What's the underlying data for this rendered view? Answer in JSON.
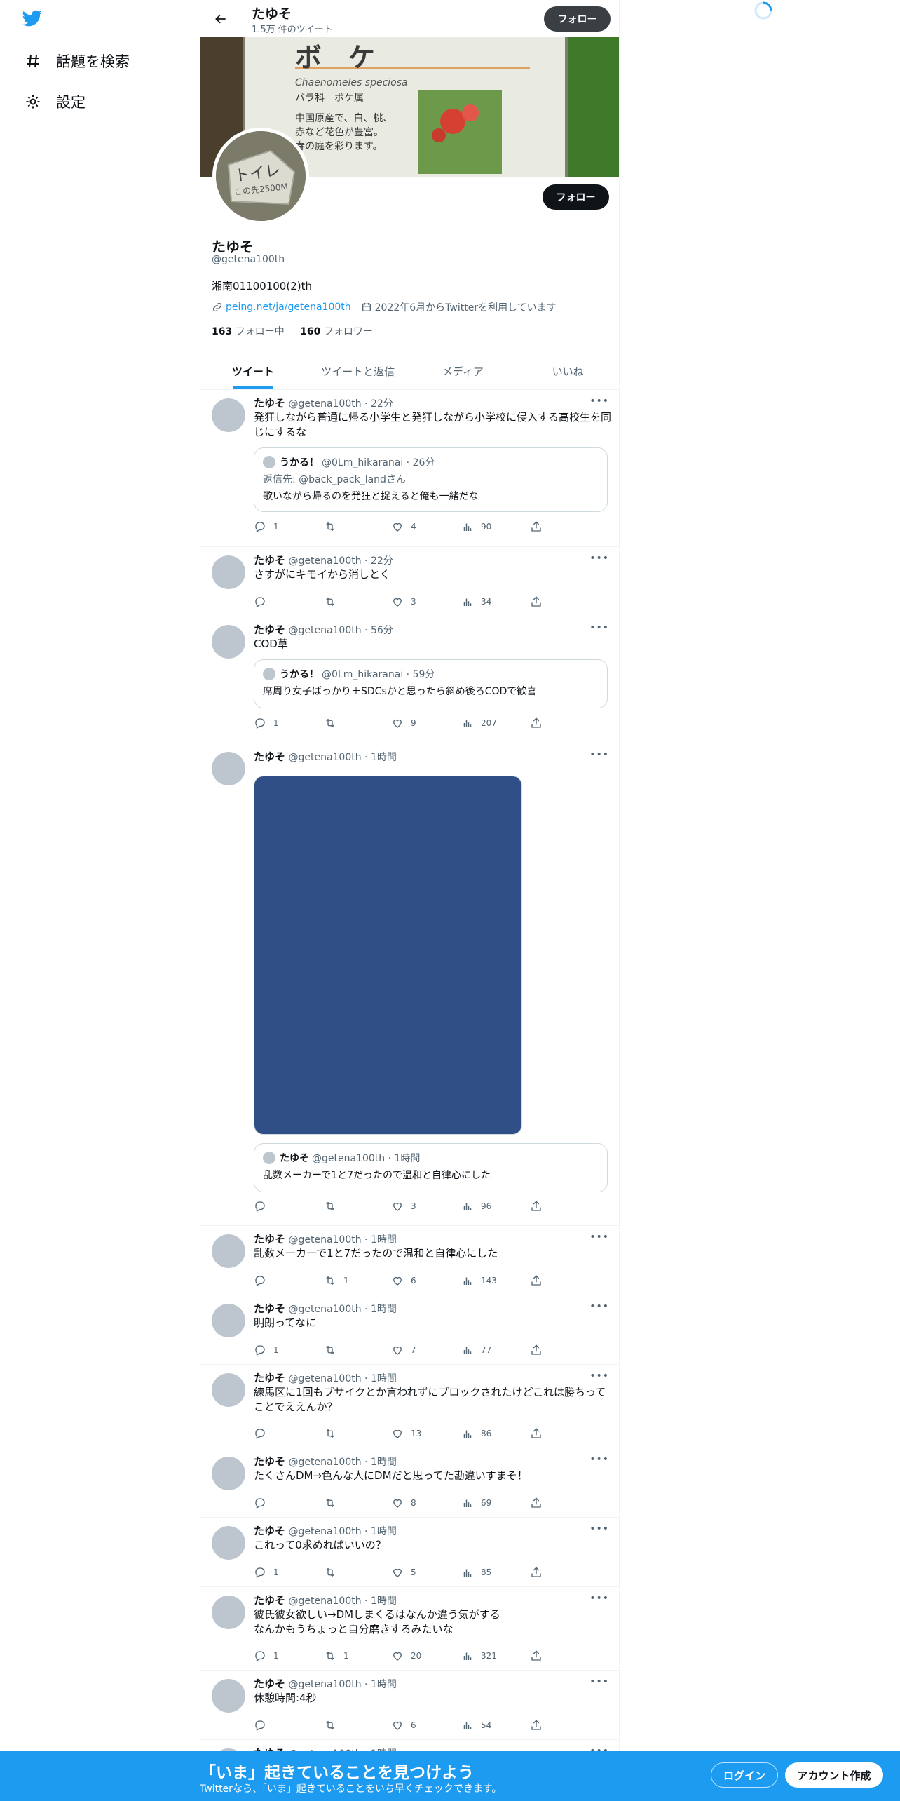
{
  "nav": {
    "logo": "twitter-bird-icon",
    "explore_label": "話題を検索",
    "settings_label": "設定"
  },
  "header": {
    "name": "たゆそ",
    "tweet_count": "1.5万 件のツイート",
    "follow_label": "フォロー"
  },
  "banner": {
    "sign_title": "ボ　ケ",
    "sign_latin": "Chaenomeles speciosa",
    "sign_family": "バラ科　ボケ属",
    "sign_desc1": "中国原産で、白、桃、",
    "sign_desc2": "赤など花色が豊富。",
    "sign_desc3": "春の庭を彩ります。"
  },
  "avatar_sign": {
    "line1": "トイレ",
    "line2": "この先2500M"
  },
  "profile": {
    "name": "たゆそ",
    "handle": "@getena100th",
    "bio": "湘南01100100(2)th",
    "link": "peing.net/ja/getena100th",
    "joined": "2022年6月からTwitterを利用しています",
    "following_count": "163",
    "following_label": "フォロー中",
    "followers_count": "160",
    "followers_label": "フォロワー",
    "follow_label": "フォロー"
  },
  "tabs": [
    "ツイート",
    "ツイートと返信",
    "メディア",
    "いいね"
  ],
  "tweets": [
    {
      "name": "たゆそ",
      "meta": "@getena100th · 22分",
      "text": "発狂しながら普通に帰る小学生と発狂しながら小学校に侵入する高校生を同じにするな",
      "quote": {
        "name": "うかる！",
        "meta": "@0Lm_hikaranai · 26分",
        "reply_prefix": "返信先: ",
        "reply_to": "@back_pack_landさん",
        "text": "歌いながら帰るのを発狂と捉えると俺も一緒だな"
      },
      "replies": "1",
      "retweets": "",
      "likes": "4",
      "views": "90"
    },
    {
      "name": "たゆそ",
      "meta": "@getena100th · 22分",
      "text": "さすがにキモイから消しとく",
      "replies": "",
      "retweets": "",
      "likes": "3",
      "views": "34"
    },
    {
      "name": "たゆそ",
      "meta": "@getena100th · 56分",
      "text": "COD草",
      "quote": {
        "name": "うかる！",
        "meta": "@0Lm_hikaranai · 59分",
        "text": "席周り女子ばっかり＋SDCsかと思ったら斜め後ろCODで歓喜"
      },
      "replies": "1",
      "retweets": "",
      "likes": "9",
      "views": "207"
    },
    {
      "name": "たゆそ",
      "meta": "@getena100th · 1時間",
      "text": "",
      "quote": {
        "name": "たゆそ",
        "meta": "@getena100th · 1時間",
        "text": "乱数メーカーで1と7だったので温和と自律心にした"
      },
      "replies": "",
      "retweets": "",
      "likes": "3",
      "views": "96"
    },
    {
      "name": "たゆそ",
      "meta": "@getena100th · 1時間",
      "text": "乱数メーカーで1と7だったので温和と自律心にした",
      "replies": "",
      "retweets": "1",
      "likes": "6",
      "views": "143"
    },
    {
      "name": "たゆそ",
      "meta": "@getena100th · 1時間",
      "text": "明朗ってなに",
      "replies": "1",
      "retweets": "",
      "likes": "7",
      "views": "77"
    },
    {
      "name": "たゆそ",
      "meta": "@getena100th · 1時間",
      "text": "練馬区に1回もブサイクとか言われずにブロックされたけどこれは勝ちってことでええんか？",
      "replies": "",
      "retweets": "",
      "likes": "13",
      "views": "86"
    },
    {
      "name": "たゆそ",
      "meta": "@getena100th · 1時間",
      "text": "たくさんDM→色んな人にDMだと思ってた勘違いすまそ！",
      "replies": "",
      "retweets": "",
      "likes": "8",
      "views": "69"
    },
    {
      "name": "たゆそ",
      "meta": "@getena100th · 1時間",
      "text": "これって0求めればいいの？",
      "replies": "1",
      "retweets": "",
      "likes": "5",
      "views": "85"
    },
    {
      "name": "たゆそ",
      "meta": "@getena100th · 1時間",
      "text": "彼氏彼女欲しい→DMしまくるはなんか違う気がする\nなんかもうちょっと自分磨きするみたいな",
      "replies": "1",
      "retweets": "1",
      "likes": "20",
      "views": "321"
    },
    {
      "name": "たゆそ",
      "meta": "@getena100th · 1時間",
      "text": "休憩時間:4秒",
      "replies": "",
      "retweets": "",
      "likes": "6",
      "views": "54"
    },
    {
      "name": "たゆそ",
      "meta": "@getena100th · 1時間",
      "text": "",
      "replies": "",
      "retweets": "",
      "likes": "",
      "views": ""
    }
  ],
  "bottom_bar": {
    "title": "「いま」起きていることを見つけよう",
    "subtitle": "Twitterなら、「いま」起きていることをいち早くチェックできます。",
    "login_label": "ログイン",
    "signup_label": "アカウント作成"
  },
  "colors": {
    "accent": "#1d9bf0",
    "text": "#0f1419",
    "muted": "#536471",
    "media_placeholder": "#2f4f86"
  }
}
